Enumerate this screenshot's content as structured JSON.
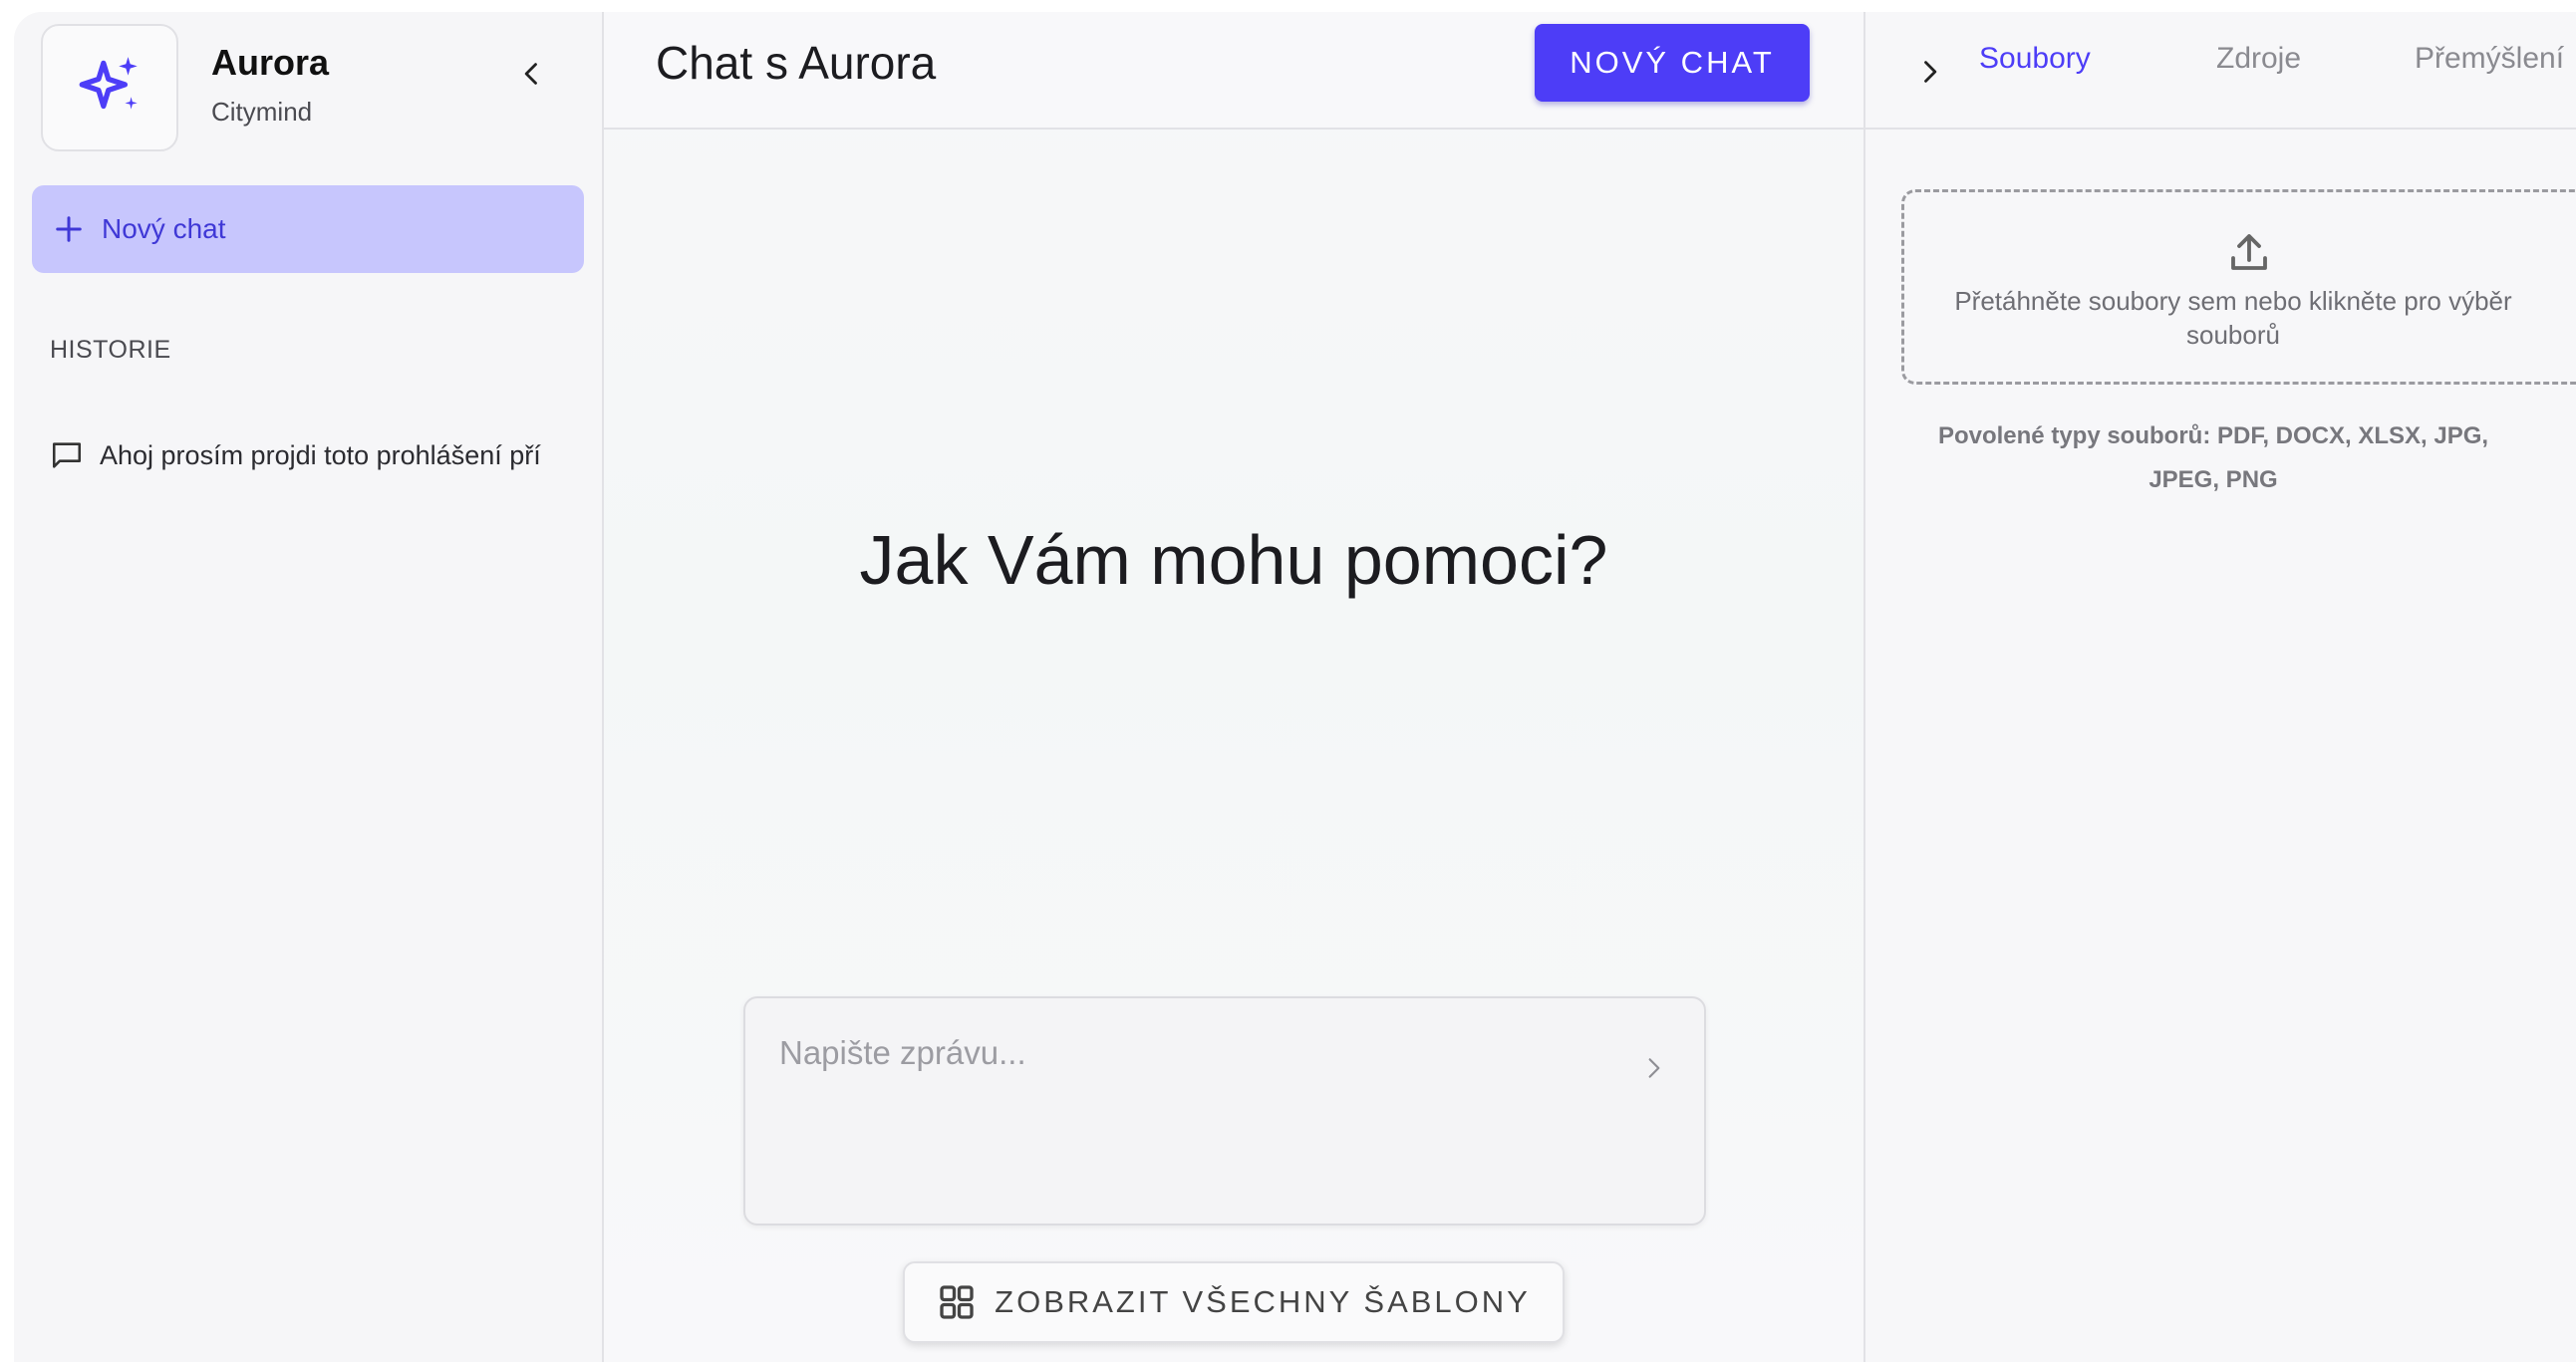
{
  "sidebar": {
    "app_name": "Aurora",
    "org_name": "Citymind",
    "new_chat_label": "Nový chat",
    "history_label": "HISTORIE",
    "history_items": [
      {
        "label": "Ahoj prosím projdi toto prohlášení pří"
      }
    ]
  },
  "main": {
    "title": "Chat s Aurora",
    "new_chat_button": "NOVÝ CHAT",
    "welcome": "Jak Vám mohu pomoci?",
    "input_placeholder": "Napište zprávu...",
    "templates_button": "ZOBRAZIT VŠECHNY ŠABLONY"
  },
  "right_panel": {
    "tabs": [
      {
        "label": "Soubory",
        "active": true
      },
      {
        "label": "Zdroje",
        "active": false
      },
      {
        "label": "Přemýšlení",
        "active": false
      }
    ],
    "dropzone_text": "Přetáhněte soubory sem nebo klikněte pro výběr souborů",
    "allowed_types": "Povolené typy souborů: PDF, DOCX, XLSX, JPG, JPEG, PNG"
  },
  "icons": {
    "logo": "sparkle-icon",
    "collapse": "chevron-left-icon",
    "new_chat": "plus-icon",
    "history_item": "chat-bubble-icon",
    "send": "chevron-right-icon",
    "templates": "grid-icon",
    "expand": "chevron-right-icon",
    "upload": "upload-icon"
  },
  "colors": {
    "accent": "#4d3df7",
    "accent_light": "#c7c6fd",
    "accent_text": "#3f38d6"
  }
}
